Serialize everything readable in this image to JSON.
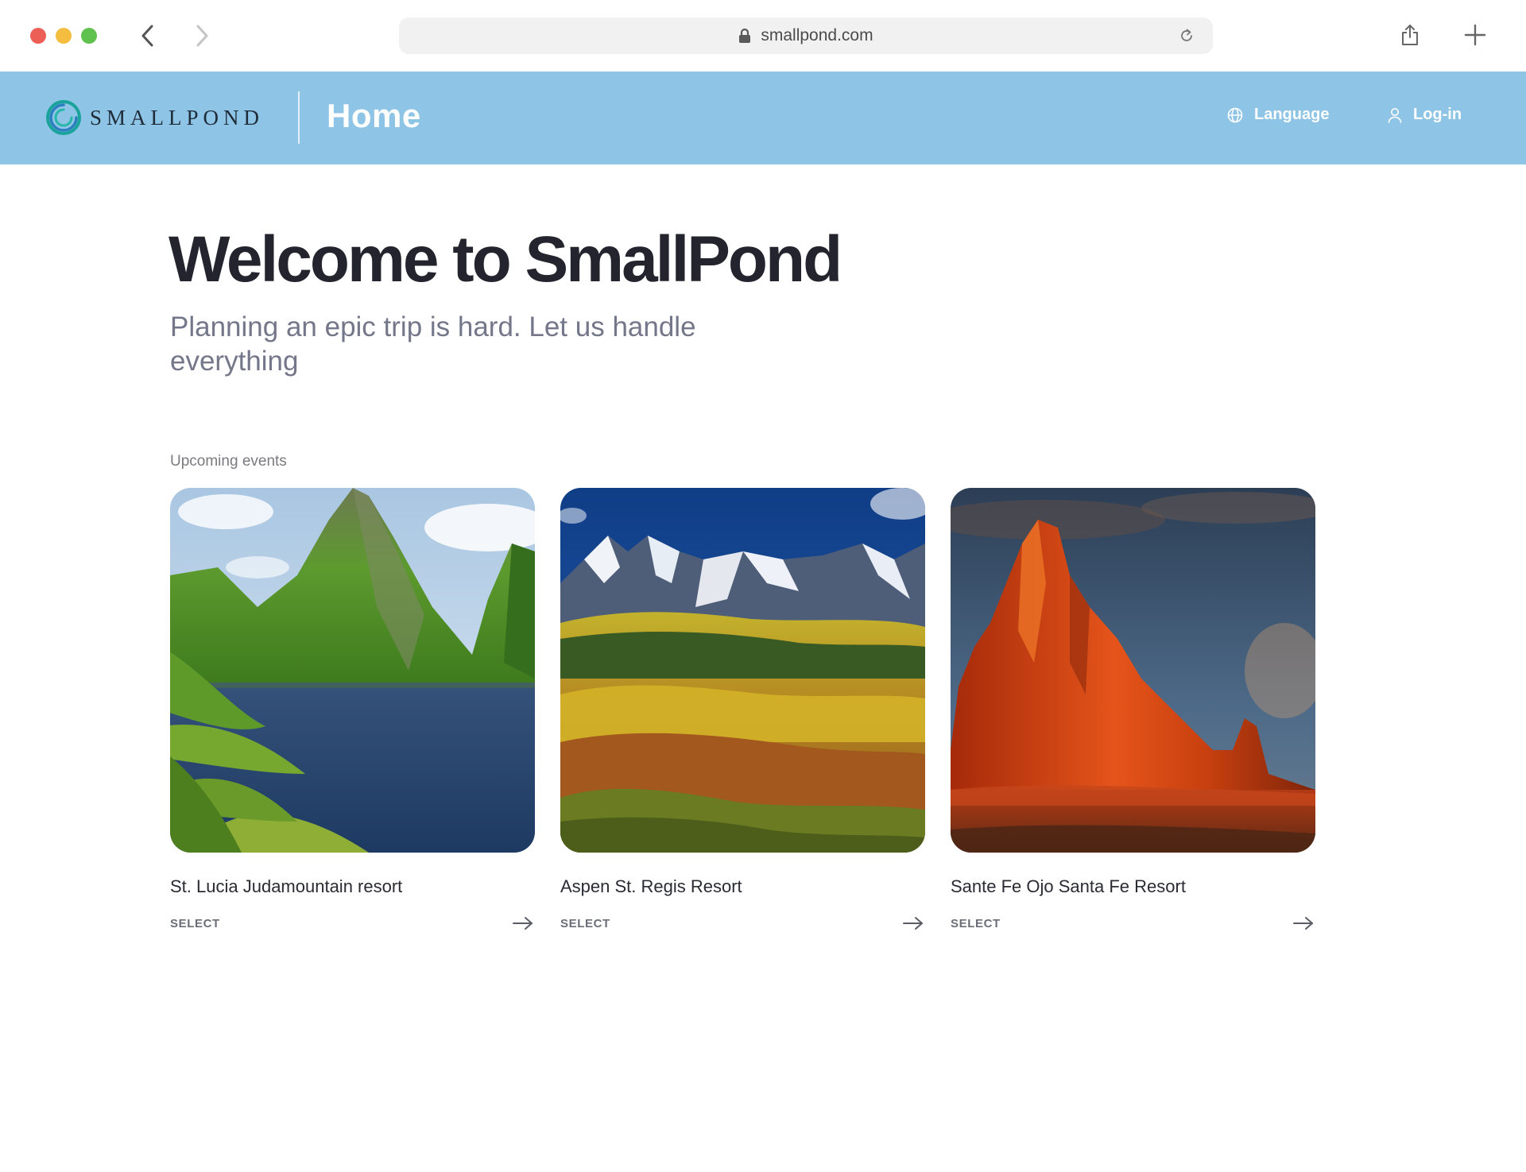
{
  "browser": {
    "url": "smallpond.com"
  },
  "header": {
    "logo_text": "SMALLPOND",
    "page_title": "Home",
    "language_label": "Language",
    "login_label": "Log-in"
  },
  "hero": {
    "title": "Welcome to SmallPond",
    "subtitle": "Planning an epic trip is hard. Let us handle everything"
  },
  "events": {
    "section_label": "Upcoming events",
    "cards": [
      {
        "title": "St. Lucia Judamountain resort",
        "action_label": "SELECT",
        "image": "tropical-mountain-bay"
      },
      {
        "title": "Aspen St. Regis Resort",
        "action_label": "SELECT",
        "image": "snowy-mountains-autumn-forest"
      },
      {
        "title": "Sante Fe Ojo Santa Fe Resort",
        "action_label": "SELECT",
        "image": "red-rock-butte"
      }
    ]
  },
  "colors": {
    "header_bg": "#8ec4e5",
    "title_text": "#23242d",
    "subtitle_text": "#74778a",
    "logo_teal": "#1aa39a"
  }
}
